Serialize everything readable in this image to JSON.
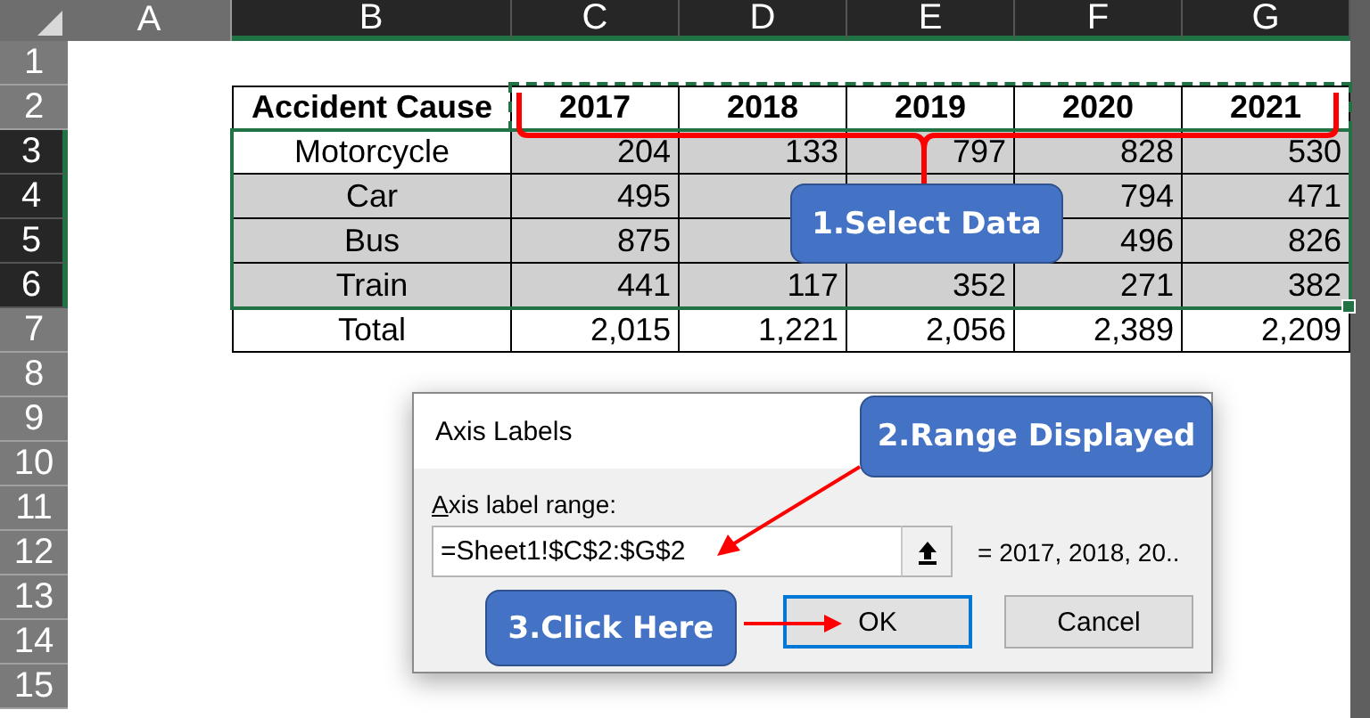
{
  "sheet": {
    "columns": [
      {
        "label": "A",
        "selected": false
      },
      {
        "label": "B",
        "selected": true
      },
      {
        "label": "C",
        "selected": true
      },
      {
        "label": "D",
        "selected": true
      },
      {
        "label": "E",
        "selected": true
      },
      {
        "label": "F",
        "selected": true
      },
      {
        "label": "G",
        "selected": true
      }
    ],
    "rows": [
      {
        "label": "1",
        "selected": false
      },
      {
        "label": "2",
        "selected": false
      },
      {
        "label": "3",
        "selected": true
      },
      {
        "label": "4",
        "selected": true
      },
      {
        "label": "5",
        "selected": true
      },
      {
        "label": "6",
        "selected": true
      },
      {
        "label": "7",
        "selected": false
      },
      {
        "label": "8",
        "selected": false
      },
      {
        "label": "9",
        "selected": false
      },
      {
        "label": "10",
        "selected": false
      },
      {
        "label": "11",
        "selected": false
      },
      {
        "label": "12",
        "selected": false
      },
      {
        "label": "13",
        "selected": false
      },
      {
        "label": "14",
        "selected": false
      },
      {
        "label": "15",
        "selected": false
      }
    ]
  },
  "table": {
    "header": [
      "Accident Cause",
      "2017",
      "2018",
      "2019",
      "2020",
      "2021"
    ],
    "rows": [
      {
        "label": "Motorcycle",
        "label_shaded": false,
        "values_shaded": true,
        "values": {
          "C": "204",
          "D": "133",
          "E": "797",
          "F": "828",
          "G": "530"
        }
      },
      {
        "label": "Car",
        "label_shaded": true,
        "values_shaded": true,
        "values": {
          "C": "495",
          "F": "794",
          "G": "471"
        }
      },
      {
        "label": "Bus",
        "label_shaded": true,
        "values_shaded": true,
        "values": {
          "C": "875",
          "F": "496",
          "G": "826"
        }
      },
      {
        "label": "Train",
        "label_shaded": true,
        "values_shaded": true,
        "values": {
          "C": "441",
          "D": "117",
          "E": "352",
          "F": "271",
          "G": "382"
        }
      },
      {
        "label": "Total",
        "label_shaded": false,
        "values_shaded": false,
        "values": {
          "C": "2,015",
          "D": "1,221",
          "E": "2,056",
          "F": "2,389",
          "G": "2,209"
        }
      }
    ]
  },
  "dialog": {
    "title": "Axis Labels",
    "field_label": "Axis label range:",
    "field_value": "=Sheet1!$C$2:$G$2",
    "preview": "= 2017, 2018, 20..",
    "buttons": [
      {
        "label": "OK",
        "default": true
      },
      {
        "label": "Cancel",
        "default": false
      }
    ]
  },
  "callouts": [
    "1.Select Data",
    "2.Range Displayed",
    "3.Click Here"
  ]
}
